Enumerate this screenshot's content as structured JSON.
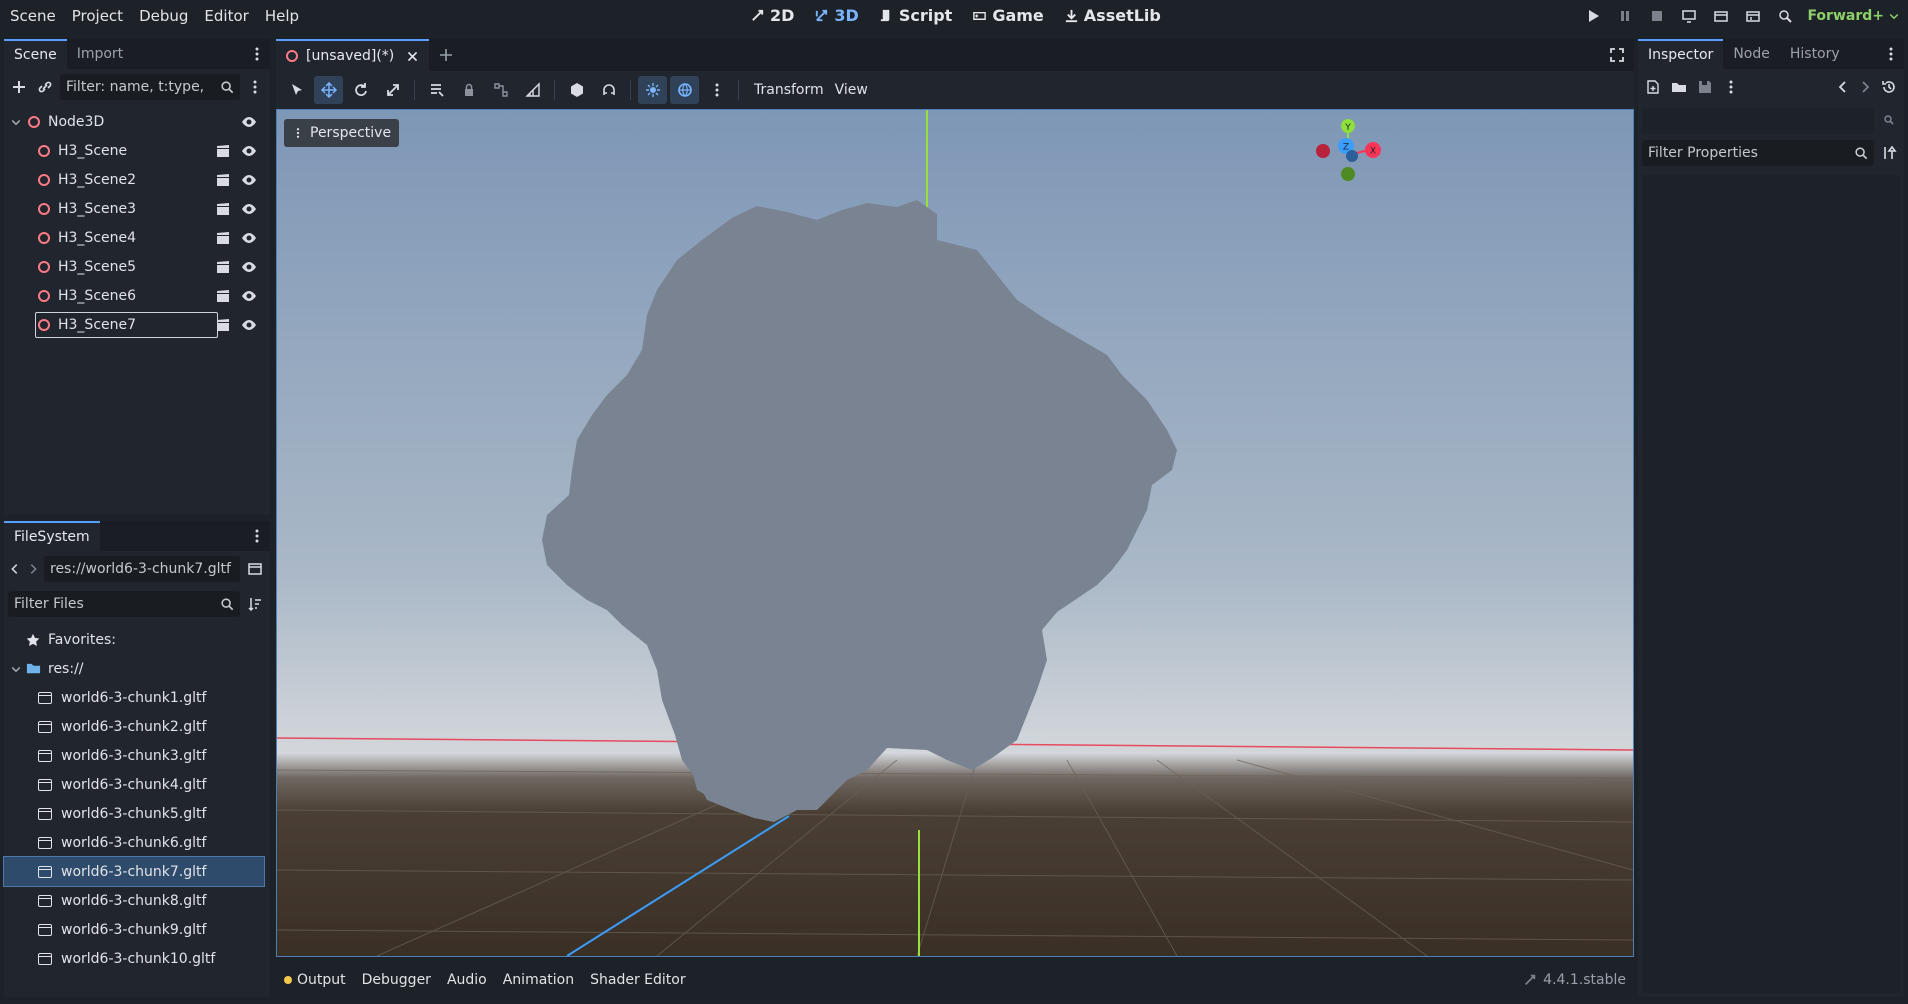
{
  "menu": [
    "Scene",
    "Project",
    "Debug",
    "Editor",
    "Help"
  ],
  "workspaces": [
    {
      "label": "2D",
      "active": false
    },
    {
      "label": "3D",
      "active": true
    },
    {
      "label": "Script",
      "active": false
    },
    {
      "label": "Game",
      "active": false
    },
    {
      "label": "AssetLib",
      "active": false
    }
  ],
  "renderer": "Forward+",
  "scene_dock": {
    "tabs": [
      "Scene",
      "Import"
    ],
    "filter_placeholder": "Filter: name, t:type,",
    "root": "Node3D",
    "nodes": [
      "H3_Scene",
      "H3_Scene2",
      "H3_Scene3",
      "H3_Scene4",
      "H3_Scene5",
      "H3_Scene6",
      "H3_Scene7"
    ],
    "selected": "H3_Scene7"
  },
  "filesystem": {
    "tab": "FileSystem",
    "path": "res://world6-3-chunk7.gltf",
    "filter_placeholder": "Filter Files",
    "favorites": "Favorites:",
    "root": "res://",
    "files": [
      "world6-3-chunk1.gltf",
      "world6-3-chunk2.gltf",
      "world6-3-chunk3.gltf",
      "world6-3-chunk4.gltf",
      "world6-3-chunk5.gltf",
      "world6-3-chunk6.gltf",
      "world6-3-chunk7.gltf",
      "world6-3-chunk8.gltf",
      "world6-3-chunk9.gltf",
      "world6-3-chunk10.gltf"
    ],
    "selected": "world6-3-chunk7.gltf"
  },
  "editor": {
    "doc_tab": "[unsaved](*)",
    "menu_transform": "Transform",
    "menu_view": "View",
    "perspective": "Perspective",
    "gizmo": {
      "y": "Y",
      "z": "Z",
      "x": "X"
    }
  },
  "inspector": {
    "tabs": [
      "Inspector",
      "Node",
      "History"
    ],
    "filter_placeholder": "Filter Properties"
  },
  "bottom_panel": {
    "tabs": [
      "Output",
      "Debugger",
      "Audio",
      "Animation",
      "Shader Editor"
    ],
    "version": "4.4.1.stable"
  },
  "colors": {
    "accent": "#569eff",
    "x_axis": "#ff3355",
    "y_axis": "#8ee03a",
    "z_axis": "#3a9dff"
  }
}
